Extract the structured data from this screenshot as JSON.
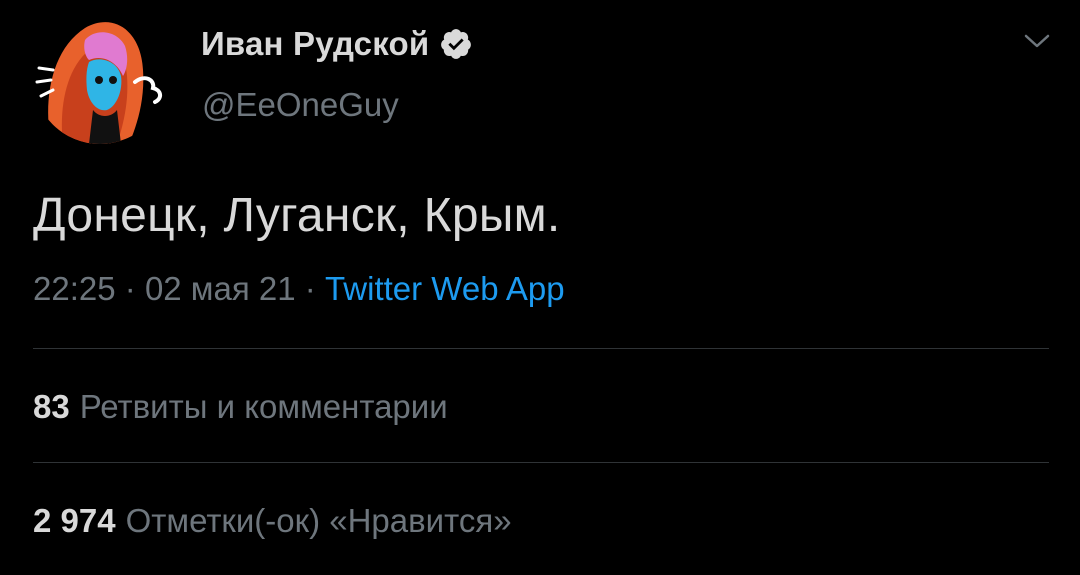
{
  "author": {
    "display_name": "Иван Рудской",
    "handle": "@EeOneGuy",
    "avatar_icon": "hooded-character-avatar",
    "verified_icon": "verified-badge-icon"
  },
  "tweet": {
    "text": "Донецк, Луганск, Крым.",
    "time": "22:25",
    "separator": "·",
    "date": "02 мая 21",
    "source": "Twitter Web App"
  },
  "stats": {
    "retweets_count": "83",
    "retweets_label": "Ретвиты и комментарии",
    "likes_count": "2 974",
    "likes_label": "Отметки(-ок) «Нравится»"
  },
  "colors": {
    "background": "#000000",
    "primary_text": "#d9d9d9",
    "secondary_text": "#6e767d",
    "accent": "#1d9bf0",
    "divider": "#2f3336"
  }
}
